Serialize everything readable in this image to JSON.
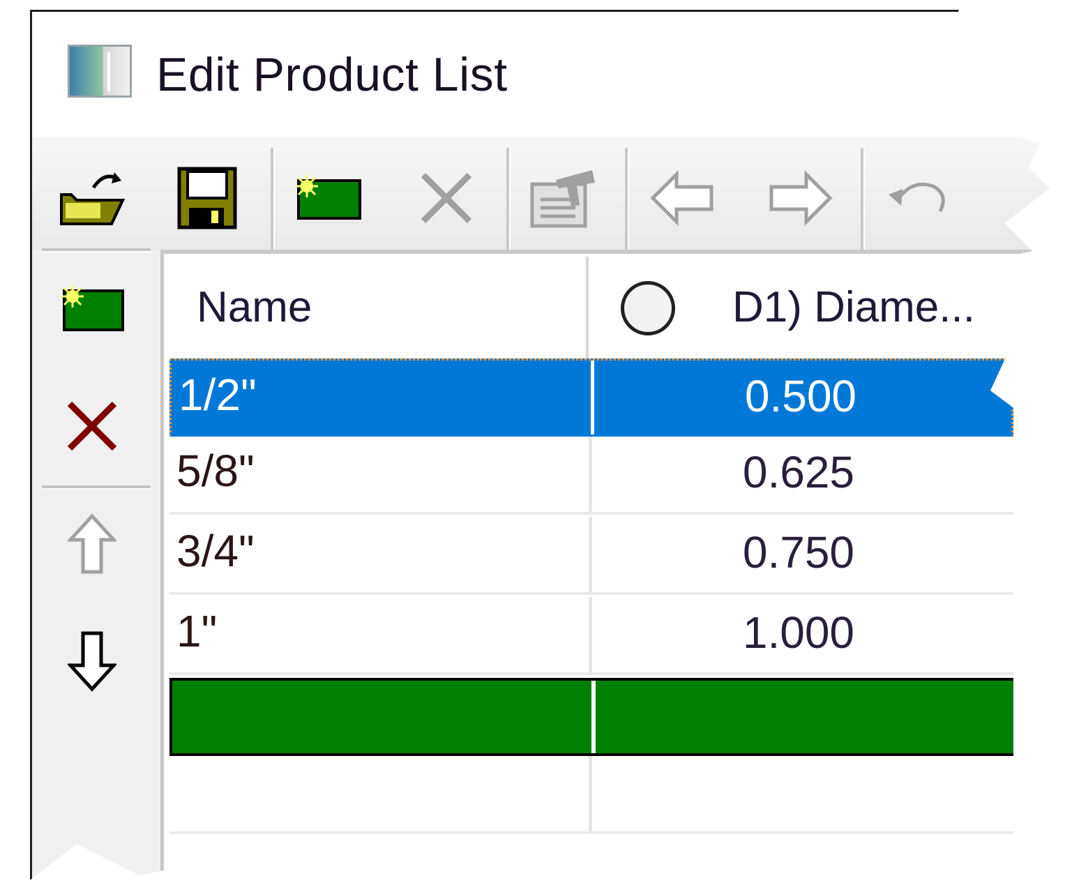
{
  "window": {
    "title": "Edit Product List"
  },
  "toolbar": {
    "buttons": [
      {
        "name": "open-file",
        "enabled": true
      },
      {
        "name": "save",
        "enabled": true
      },
      {
        "name": "new-item",
        "enabled": true
      },
      {
        "name": "delete",
        "enabled": false
      },
      {
        "name": "properties",
        "enabled": false
      },
      {
        "name": "move-left",
        "enabled": false
      },
      {
        "name": "move-right",
        "enabled": false
      },
      {
        "name": "undo",
        "enabled": false
      }
    ]
  },
  "sidebar": {
    "buttons": [
      {
        "name": "add-row",
        "enabled": true
      },
      {
        "name": "delete-row",
        "enabled": true
      },
      {
        "name": "move-up",
        "enabled": false
      },
      {
        "name": "move-down",
        "enabled": true
      }
    ]
  },
  "table": {
    "columns": [
      "Name",
      "D1) Diame..."
    ],
    "rows": [
      {
        "name": "1/2\"",
        "diameter": "0.500",
        "selected": true
      },
      {
        "name": "5/8\"",
        "diameter": "0.625",
        "selected": false
      },
      {
        "name": "3/4\"",
        "diameter": "0.750",
        "selected": false
      },
      {
        "name": "1\"",
        "diameter": "1.000",
        "selected": false
      }
    ]
  },
  "colors": {
    "selection": "#0078d7",
    "new_row": "#008000",
    "focus_border": "#e9942c"
  }
}
